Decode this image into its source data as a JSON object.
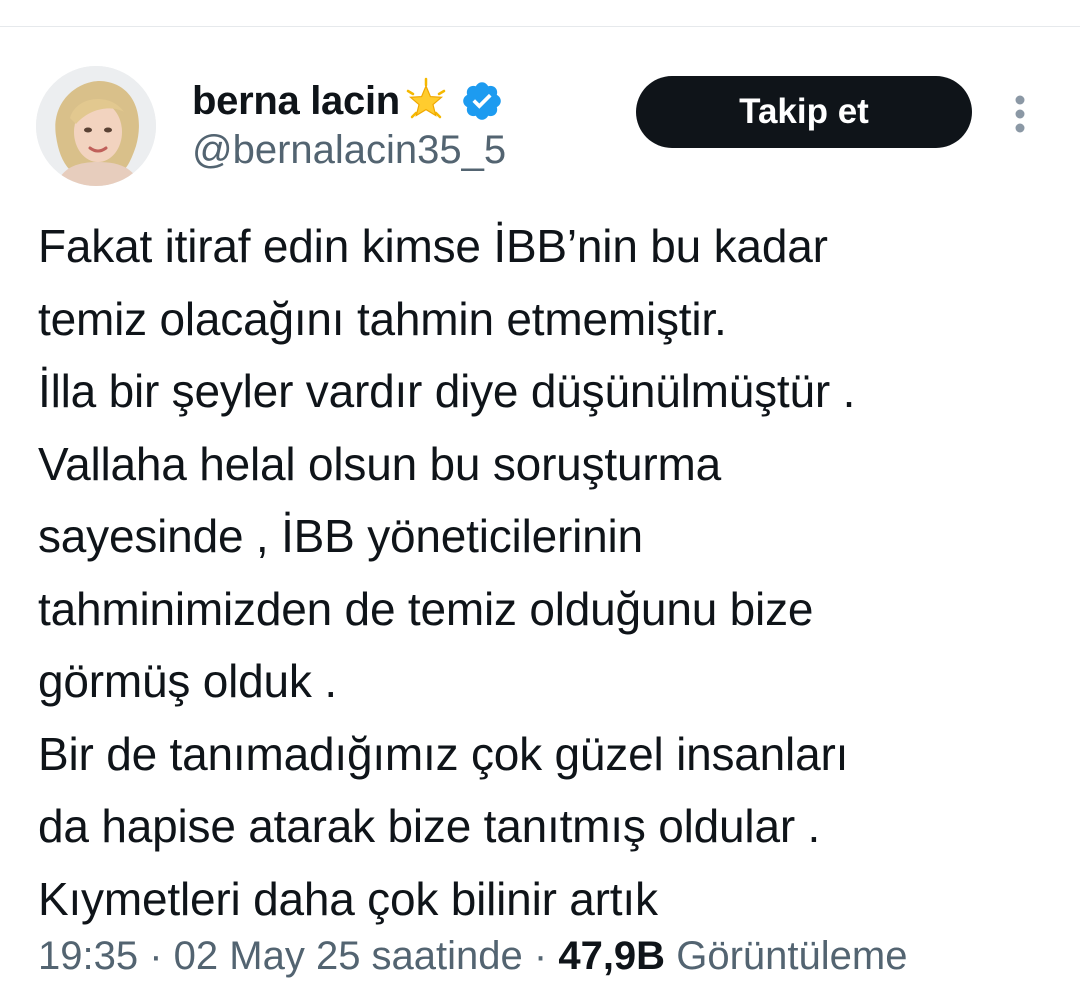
{
  "author": {
    "display_name": "berna lacin",
    "handle": "@bernalacin35_5",
    "name_emoji_icon": "glowing-star-icon",
    "verified_icon": "verified-badge-icon",
    "verified_color": "#1d9bf0"
  },
  "actions": {
    "follow_label": "Takip et",
    "more_icon": "more-vertical-icon"
  },
  "tweet": {
    "lines": [
      "Fakat itiraf edin kimse İBB’nin bu kadar",
      "temiz olacağını tahmin etmemiştir.",
      "İlla bir şeyler vardır diye düşünülmüştür .",
      "Vallaha helal olsun bu soruşturma",
      "sayesinde , İBB yöneticilerinin",
      "tahminimizden de temiz olduğunu bize",
      "görmüş olduk .",
      "Bir de tanımadığımız çok güzel insanları",
      "da hapise atarak bize tanıtmış oldular .",
      "Kıymetleri daha çok bilinir artık"
    ]
  },
  "meta": {
    "time": "19:35",
    "separator": " · ",
    "date": "02 May 25 saatinde",
    "views_count": "47,9B",
    "views_label": "Görüntüleme"
  },
  "colors": {
    "text": "#0f1419",
    "muted": "#536471",
    "follow_bg": "#0f1419",
    "follow_text": "#ffffff"
  }
}
